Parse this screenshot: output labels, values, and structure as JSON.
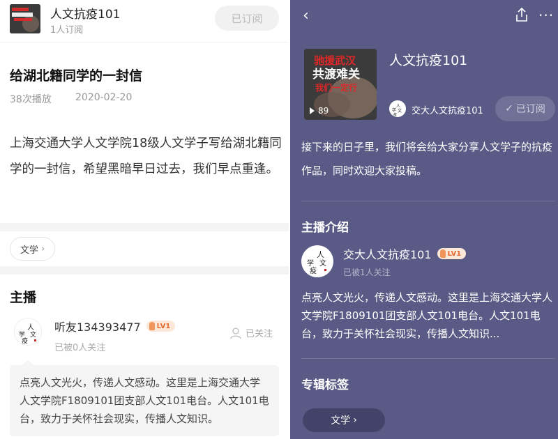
{
  "left": {
    "album": {
      "title": "人文抗疫101",
      "subscribers": "1人订阅",
      "subscribe_button": "已订阅"
    },
    "episode": {
      "title": "给湖北籍同学的一封信",
      "plays": "38次播放",
      "date": "2020-02-20",
      "description": "上海交通大学人文学院18级人文学子写给湖北籍同学的一封信，希望黑暗早日过去，我们早点重逢。"
    },
    "tag": {
      "label": "文学",
      "chevron": "›"
    },
    "host": {
      "heading": "主播",
      "name": "听友134393477",
      "level": "LV1",
      "followers": "已被0人关注",
      "follow_button": "已关注",
      "intro": "点亮人文光火，传递人文感动。这里是上海交通大学人文学院F1809101团支部人文101电台。人文101电台，致力于关怀社会现实，传播人文知识。"
    }
  },
  "right": {
    "back_icon": "‹",
    "more_icon": "···",
    "album": {
      "title": "人文抗疫101",
      "host_name": "交大人文抗疫101",
      "subscribe_button": "已订阅",
      "subscribe_check": "✓",
      "play_count": "89",
      "description": "接下来的日子里，我们将会给大家分享人文学子的抗疫作品，同时欢迎大家投稿。"
    },
    "host_section": {
      "heading": "主播介绍",
      "name": "交大人文抗疫101",
      "level": "LV1",
      "followers": "已被1人关注",
      "intro": "点亮人文光火，传递人文感动。这里是上海交通大学人文学院F1809101团支部人文101电台。人文101电台，致力于关怀社会现实，传播人文知识..."
    },
    "tags_section": {
      "heading": "专辑标签",
      "tag_label": "文学",
      "chevron": "›"
    }
  },
  "cover_text": {
    "line1": "驰援武汉",
    "line2": "共渡难关",
    "line3": "我们一定行"
  },
  "avatar_text": {
    "ren": "人",
    "wen": "文",
    "xue": "学",
    "yi": "疫"
  },
  "colors": {
    "right_panel_bg": "#5a5a86",
    "badge_bg": "#fde7d8",
    "badge_text": "#e86a2e"
  }
}
